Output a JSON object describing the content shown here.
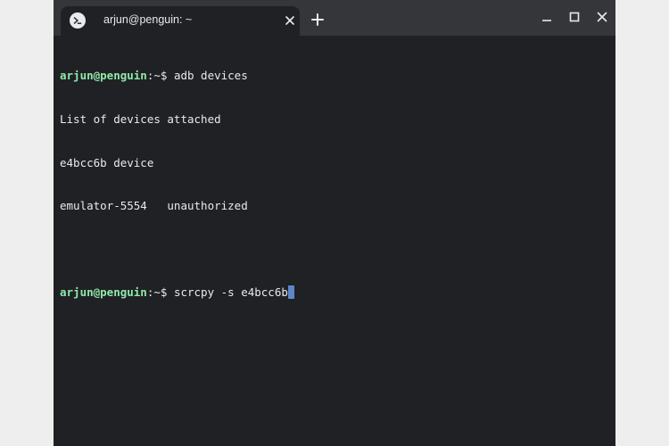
{
  "window": {
    "tab_title": "arjun@penguin: ~",
    "new_tab_symbol": "+",
    "icons": {
      "tab_app": "terminal-prompt-icon",
      "tab_close": "close-icon",
      "new_tab": "plus-icon",
      "minimize": "minimize-icon",
      "maximize": "maximize-icon",
      "close": "close-icon"
    }
  },
  "terminal": {
    "prompt_user": "arjun@penguin",
    "prompt_path": ":~$ ",
    "command_1": "adb devices",
    "output_1": "List of devices attached",
    "output_2": "e4bcc6b device",
    "output_3": "emulator-5554   unauthorized",
    "command_2": "scrcpy -s e4bcc6b"
  },
  "colors": {
    "terminal_bg": "#202124",
    "titlebar_bg": "#35363a",
    "prompt_user": "#8ee8a9",
    "text": "#e8eaed",
    "cursor": "#5d86c7"
  }
}
